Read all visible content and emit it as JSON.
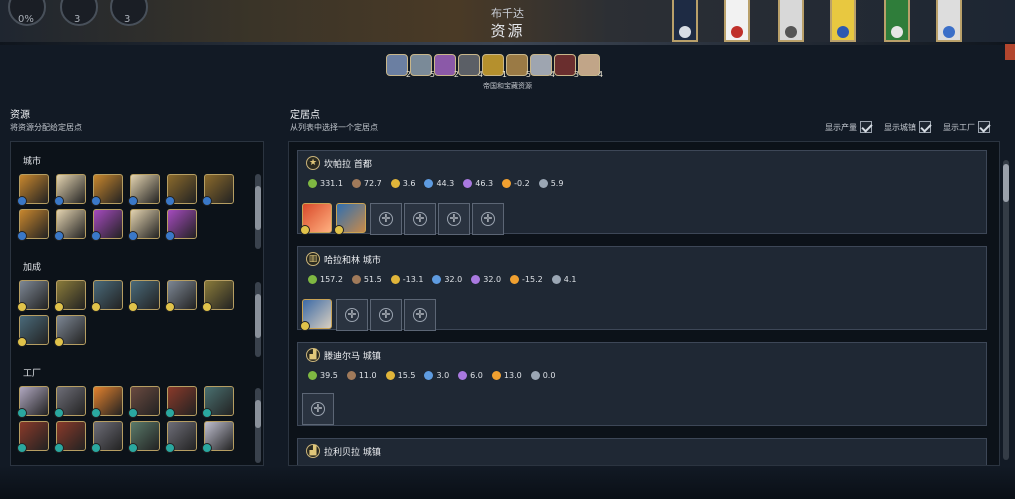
{
  "top_hud": {
    "percent": "0%",
    "count_a": "3",
    "count_b": "3"
  },
  "header": {
    "subtitle": "布千达",
    "title": "资源"
  },
  "empire_resources": {
    "label": "帝国和宝藏资源",
    "chips": [
      {
        "icon": "shield-resource-icon",
        "count": "2",
        "color": "#6b7fa2"
      },
      {
        "icon": "ink-resource-icon",
        "count": "5",
        "color": "#7a8a98"
      },
      {
        "icon": "silk-resource-icon",
        "count": "2",
        "color": "#8b59a8"
      },
      {
        "icon": "iron-resource-icon",
        "count": "4",
        "color": "#5b5f66"
      },
      {
        "icon": "gold-resource-icon",
        "count": "1",
        "color": "#b5902d"
      },
      {
        "icon": "wood-resource-icon",
        "count": "5",
        "color": "#9a7a45"
      },
      {
        "icon": "marble-resource-icon",
        "count": "4",
        "color": "#9ea5b0"
      },
      {
        "icon": "wine-resource-icon",
        "count": "3",
        "color": "#6a2e2e"
      },
      {
        "icon": "ivory-resource-icon",
        "count": "4",
        "color": "#c1a588"
      }
    ]
  },
  "left": {
    "heading": "资源",
    "subheading": "将资源分配给定居点",
    "groups": [
      {
        "label": "城市"
      },
      {
        "label": "加成"
      },
      {
        "label": "工厂"
      }
    ]
  },
  "right": {
    "heading": "定居点",
    "subheading": "从列表中选择一个定居点",
    "toggles": [
      {
        "label": "显示产量"
      },
      {
        "label": "显示城镇"
      },
      {
        "label": "显示工厂"
      }
    ],
    "settlements": [
      {
        "icon": "capital-star-icon",
        "glyph": "★",
        "name": "坎帕拉 首都",
        "yields": [
          "331.1",
          "72.7",
          "3.6",
          "44.3",
          "46.3",
          "-0.2",
          "5.9"
        ]
      },
      {
        "icon": "city-building-icon",
        "glyph": "▥",
        "name": "哈拉和林 城市",
        "yields": [
          "157.2",
          "51.5",
          "-13.1",
          "32.0",
          "32.0",
          "-15.2",
          "4.1"
        ]
      },
      {
        "icon": "town-building-icon",
        "glyph": "▟",
        "name": "滕迪尔马 城镇",
        "yields": [
          "39.5",
          "11.0",
          "15.5",
          "3.0",
          "6.0",
          "13.0",
          "0.0"
        ]
      },
      {
        "icon": "town-building-icon",
        "glyph": "▟",
        "name": "拉利贝拉 城镇"
      }
    ]
  },
  "yield_icons": [
    {
      "name": "food-icon",
      "color": "#7fb842"
    },
    {
      "name": "production-icon",
      "color": "#a07a5a"
    },
    {
      "name": "gold-icon",
      "color": "#e0b53a"
    },
    {
      "name": "science-icon",
      "color": "#5e9be0"
    },
    {
      "name": "culture-icon",
      "color": "#a979e0"
    },
    {
      "name": "happiness-icon",
      "color": "#f0a030"
    },
    {
      "name": "influence-icon",
      "color": "#9aa6b4"
    }
  ]
}
